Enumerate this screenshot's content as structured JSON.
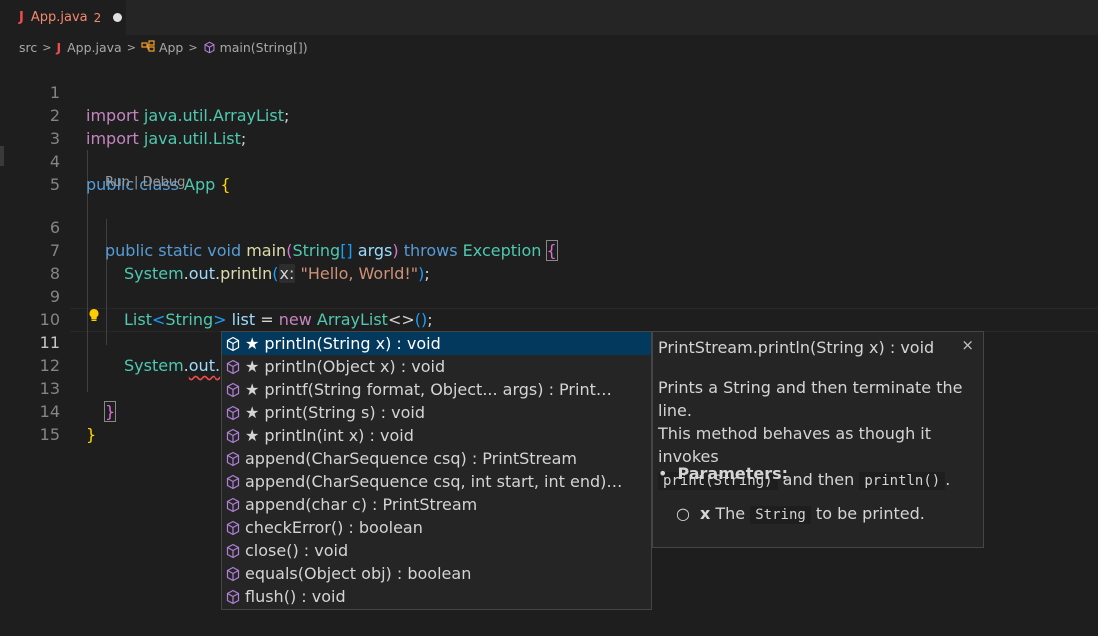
{
  "tab": {
    "icon": "J",
    "name": "App.java",
    "problems": "2"
  },
  "breadcrumb": {
    "src": "src",
    "file_icon": "J",
    "file": "App.java",
    "class": "App",
    "method": "main(String[])"
  },
  "codelens": "Run | Debug",
  "line_numbers": [
    "1",
    "2",
    "3",
    "4",
    "5",
    "6",
    "7",
    "8",
    "9",
    "10",
    "11",
    "12",
    "13",
    "14",
    "15"
  ],
  "code": {
    "l1": {
      "kw": "import",
      "path": "java.util.",
      "type": "ArrayList",
      "end": ";"
    },
    "l2": {
      "kw": "import",
      "path": "java.util.",
      "type": "List",
      "end": ";"
    },
    "l4": {
      "kw1": "public",
      "kw2": "class",
      "name": "App",
      "brace": "{"
    },
    "l6": {
      "mods": "public static void",
      "fn": "main",
      "open": "(",
      "type": "String",
      "arr": "[]",
      "arg": "args",
      "close": ")",
      "throws": "throws",
      "exc": "Exception",
      "brace": "{"
    },
    "l7": {
      "obj": "System",
      "field": "out",
      "fn": "println",
      "open": "(",
      "hint": "x:",
      "str": "\"Hello, World!\"",
      "close": ")",
      "end": ";"
    },
    "l9": {
      "type": "List",
      "lt": "<",
      "gtype": "String",
      "gt": ">",
      "var": "list",
      "eq": "=",
      "new": "new",
      "cls": "ArrayList",
      "diamond": "<>",
      "open": "(",
      "close": ")",
      "end": ";"
    },
    "l11": {
      "obj": "System",
      "field": "out",
      "dot": "."
    },
    "l13": {
      "brace": "}"
    },
    "l14": {
      "brace": "}"
    }
  },
  "suggest": {
    "items": [
      {
        "star": "★",
        "label": "println(String x) : void"
      },
      {
        "star": "★",
        "label": "println(Object x) : void"
      },
      {
        "star": "★",
        "label": "printf(String format, Object... args) : Print…"
      },
      {
        "star": "★",
        "label": "print(String s) : void"
      },
      {
        "star": "★",
        "label": "println(int x) : void"
      },
      {
        "star": "",
        "label": "append(CharSequence csq) : PrintStream"
      },
      {
        "star": "",
        "label": "append(CharSequence csq, int start, int end)…"
      },
      {
        "star": "",
        "label": "append(char c) : PrintStream"
      },
      {
        "star": "",
        "label": "checkError() : boolean"
      },
      {
        "star": "",
        "label": "close() : void"
      },
      {
        "star": "",
        "label": "equals(Object obj) : boolean"
      },
      {
        "star": "",
        "label": "flush() : void"
      }
    ]
  },
  "details": {
    "title": "PrintStream.println(String x) : void",
    "close": "×",
    "desc1": "Prints a String and then terminate the line.",
    "desc2": "This method behaves as though it invokes",
    "code1": "print(String)",
    "and_then": "and then",
    "code2": "println()",
    "period": ".",
    "params_label": "Parameters:",
    "param_name": "x",
    "param_the": "The",
    "param_code": "String",
    "param_rest": "to be printed."
  },
  "colors": {
    "keyword": "#569cd6",
    "type": "#4ec9b0",
    "variable": "#9cdcfe",
    "function": "#dcdcaa",
    "string": "#ce9178",
    "selection": "#04395e",
    "method_icon": "#b180d7"
  }
}
